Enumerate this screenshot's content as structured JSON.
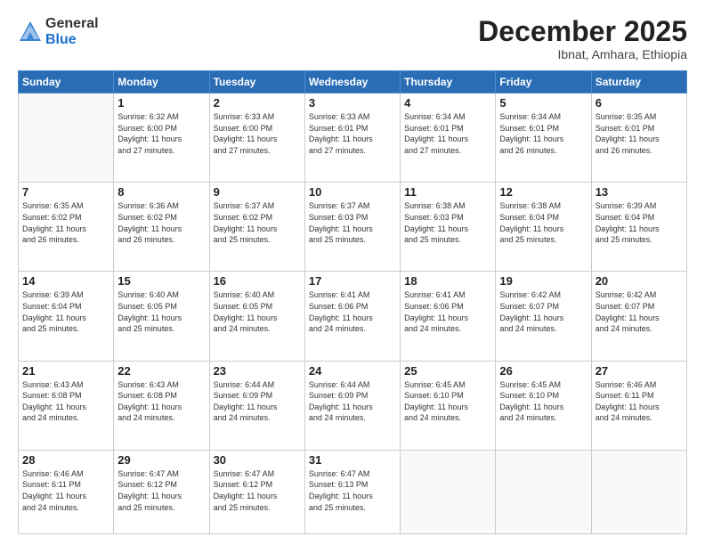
{
  "header": {
    "logo_general": "General",
    "logo_blue": "Blue",
    "title": "December 2025",
    "subtitle": "Ibnat, Amhara, Ethiopia"
  },
  "days_of_week": [
    "Sunday",
    "Monday",
    "Tuesday",
    "Wednesday",
    "Thursday",
    "Friday",
    "Saturday"
  ],
  "weeks": [
    [
      {
        "day": "",
        "info": ""
      },
      {
        "day": "1",
        "info": "Sunrise: 6:32 AM\nSunset: 6:00 PM\nDaylight: 11 hours\nand 27 minutes."
      },
      {
        "day": "2",
        "info": "Sunrise: 6:33 AM\nSunset: 6:00 PM\nDaylight: 11 hours\nand 27 minutes."
      },
      {
        "day": "3",
        "info": "Sunrise: 6:33 AM\nSunset: 6:01 PM\nDaylight: 11 hours\nand 27 minutes."
      },
      {
        "day": "4",
        "info": "Sunrise: 6:34 AM\nSunset: 6:01 PM\nDaylight: 11 hours\nand 27 minutes."
      },
      {
        "day": "5",
        "info": "Sunrise: 6:34 AM\nSunset: 6:01 PM\nDaylight: 11 hours\nand 26 minutes."
      },
      {
        "day": "6",
        "info": "Sunrise: 6:35 AM\nSunset: 6:01 PM\nDaylight: 11 hours\nand 26 minutes."
      }
    ],
    [
      {
        "day": "7",
        "info": "Sunrise: 6:35 AM\nSunset: 6:02 PM\nDaylight: 11 hours\nand 26 minutes."
      },
      {
        "day": "8",
        "info": "Sunrise: 6:36 AM\nSunset: 6:02 PM\nDaylight: 11 hours\nand 26 minutes."
      },
      {
        "day": "9",
        "info": "Sunrise: 6:37 AM\nSunset: 6:02 PM\nDaylight: 11 hours\nand 25 minutes."
      },
      {
        "day": "10",
        "info": "Sunrise: 6:37 AM\nSunset: 6:03 PM\nDaylight: 11 hours\nand 25 minutes."
      },
      {
        "day": "11",
        "info": "Sunrise: 6:38 AM\nSunset: 6:03 PM\nDaylight: 11 hours\nand 25 minutes."
      },
      {
        "day": "12",
        "info": "Sunrise: 6:38 AM\nSunset: 6:04 PM\nDaylight: 11 hours\nand 25 minutes."
      },
      {
        "day": "13",
        "info": "Sunrise: 6:39 AM\nSunset: 6:04 PM\nDaylight: 11 hours\nand 25 minutes."
      }
    ],
    [
      {
        "day": "14",
        "info": "Sunrise: 6:39 AM\nSunset: 6:04 PM\nDaylight: 11 hours\nand 25 minutes."
      },
      {
        "day": "15",
        "info": "Sunrise: 6:40 AM\nSunset: 6:05 PM\nDaylight: 11 hours\nand 25 minutes."
      },
      {
        "day": "16",
        "info": "Sunrise: 6:40 AM\nSunset: 6:05 PM\nDaylight: 11 hours\nand 24 minutes."
      },
      {
        "day": "17",
        "info": "Sunrise: 6:41 AM\nSunset: 6:06 PM\nDaylight: 11 hours\nand 24 minutes."
      },
      {
        "day": "18",
        "info": "Sunrise: 6:41 AM\nSunset: 6:06 PM\nDaylight: 11 hours\nand 24 minutes."
      },
      {
        "day": "19",
        "info": "Sunrise: 6:42 AM\nSunset: 6:07 PM\nDaylight: 11 hours\nand 24 minutes."
      },
      {
        "day": "20",
        "info": "Sunrise: 6:42 AM\nSunset: 6:07 PM\nDaylight: 11 hours\nand 24 minutes."
      }
    ],
    [
      {
        "day": "21",
        "info": "Sunrise: 6:43 AM\nSunset: 6:08 PM\nDaylight: 11 hours\nand 24 minutes."
      },
      {
        "day": "22",
        "info": "Sunrise: 6:43 AM\nSunset: 6:08 PM\nDaylight: 11 hours\nand 24 minutes."
      },
      {
        "day": "23",
        "info": "Sunrise: 6:44 AM\nSunset: 6:09 PM\nDaylight: 11 hours\nand 24 minutes."
      },
      {
        "day": "24",
        "info": "Sunrise: 6:44 AM\nSunset: 6:09 PM\nDaylight: 11 hours\nand 24 minutes."
      },
      {
        "day": "25",
        "info": "Sunrise: 6:45 AM\nSunset: 6:10 PM\nDaylight: 11 hours\nand 24 minutes."
      },
      {
        "day": "26",
        "info": "Sunrise: 6:45 AM\nSunset: 6:10 PM\nDaylight: 11 hours\nand 24 minutes."
      },
      {
        "day": "27",
        "info": "Sunrise: 6:46 AM\nSunset: 6:11 PM\nDaylight: 11 hours\nand 24 minutes."
      }
    ],
    [
      {
        "day": "28",
        "info": "Sunrise: 6:46 AM\nSunset: 6:11 PM\nDaylight: 11 hours\nand 24 minutes."
      },
      {
        "day": "29",
        "info": "Sunrise: 6:47 AM\nSunset: 6:12 PM\nDaylight: 11 hours\nand 25 minutes."
      },
      {
        "day": "30",
        "info": "Sunrise: 6:47 AM\nSunset: 6:12 PM\nDaylight: 11 hours\nand 25 minutes."
      },
      {
        "day": "31",
        "info": "Sunrise: 6:47 AM\nSunset: 6:13 PM\nDaylight: 11 hours\nand 25 minutes."
      },
      {
        "day": "",
        "info": ""
      },
      {
        "day": "",
        "info": ""
      },
      {
        "day": "",
        "info": ""
      }
    ]
  ]
}
